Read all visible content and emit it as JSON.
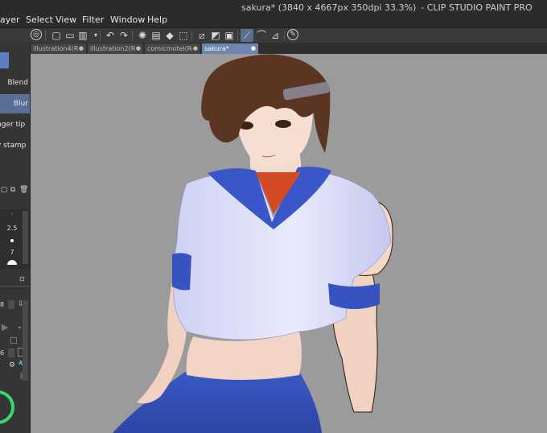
{
  "app": {
    "title": "sakura* (3840 x 4667px 350dpi 33.3%)",
    "title_suffix": "- CLIP STUDIO PAINT PRO"
  },
  "menu": {
    "items": [
      {
        "label": "ayer"
      },
      {
        "label": "Select"
      },
      {
        "label": "View"
      },
      {
        "label": "Filter"
      },
      {
        "label": "Window"
      },
      {
        "label": "Help"
      }
    ]
  },
  "toolbar": {
    "icons": [
      "clip-studio-icon",
      "new-icon",
      "open-icon",
      "save-icon",
      "chevron-down-icon",
      "undo-icon",
      "redo-icon",
      "loading-icon",
      "fill-icon",
      "transform-icon",
      "selection-icon",
      "clear-selection-icon",
      "invert-icon",
      "border-icon",
      "snap-ruler-icon",
      "snap-special-icon",
      "snap-grid-icon",
      "brush-settings-icon"
    ]
  },
  "tabs": [
    {
      "label": "illustration4(Re",
      "active": false
    },
    {
      "label": "illustration2(Re",
      "active": false
    },
    {
      "label": "comicmotel(Re",
      "active": false
    },
    {
      "label": "sakura*",
      "active": true
    }
  ],
  "left_panel": {
    "subtools": [
      {
        "label": "Blend"
      },
      {
        "label": "Blur"
      },
      {
        "label": "nger tip"
      },
      {
        "label": "y stamp"
      }
    ],
    "brush_sizes": [
      "·",
      "2.5",
      "7"
    ],
    "property_values": [
      "8",
      "6"
    ]
  },
  "colors": {
    "accent": "#6d86b1",
    "menubar": "#2b2b2b",
    "canvas_bg": "#9b9b9b",
    "color_ring": "#38d96b"
  }
}
